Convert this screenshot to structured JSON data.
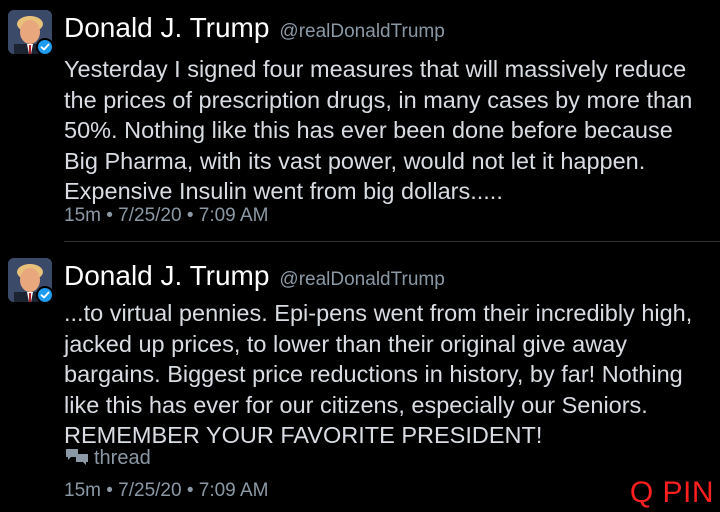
{
  "tweets": [
    {
      "author": {
        "display_name": "Donald J. Trump",
        "handle": "@realDonaldTrump",
        "avatar_icon": "profile-photo",
        "verified_icon": "verified-badge-icon"
      },
      "text": "Yesterday I signed four measures that will massively reduce\nthe prices of prescription drugs, in many cases by more than\n50%. Nothing like this has ever been done before because\nBig Pharma, with its vast power, would not let it happen.\nExpensive Insulin went from big dollars.....",
      "meta": "15m • 7/25/20 • 7:09 AM"
    },
    {
      "author": {
        "display_name": "Donald J. Trump",
        "handle": "@realDonaldTrump",
        "avatar_icon": "profile-photo",
        "verified_icon": "verified-badge-icon"
      },
      "text": "...to virtual pennies. Epi-pens went from their incredibly high,\njacked up prices, to lower than their original give away\nbargains. Biggest price reductions in history, by far! Nothing\nlike this has ever for our citizens, especially our Seniors.\nREMEMBER YOUR FAVORITE PRESIDENT!",
      "thread_label": "thread",
      "thread_icon": "conversation-bubbles-icon",
      "meta": "15m • 7/25/20 • 7:09 AM"
    }
  ],
  "watermark": "Q PIN",
  "colors": {
    "background": "#000000",
    "name": "#ffffff",
    "body": "#d9dde3",
    "secondary": "#8b98a5",
    "verified": "#1d9bf0",
    "watermark": "#ff1f1f",
    "divider": "#2f3336"
  }
}
